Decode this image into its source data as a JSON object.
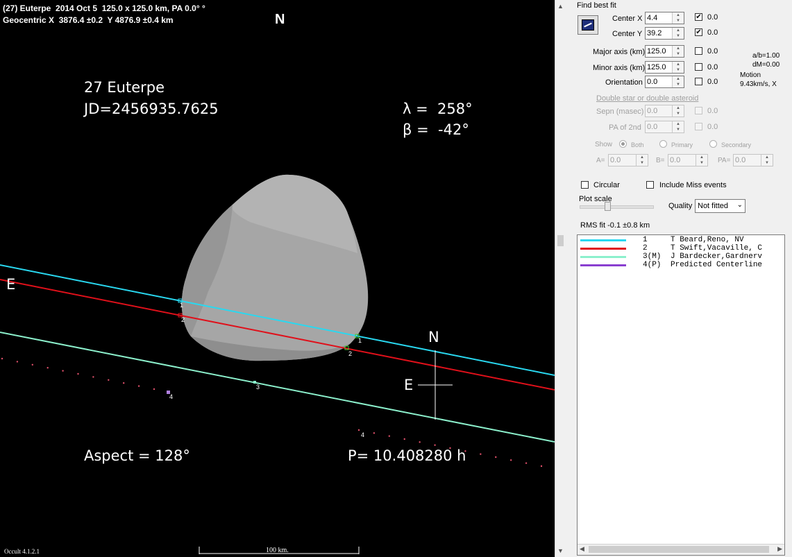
{
  "plot": {
    "header_line1": "(27) Euterpe  2014 Oct 5  125.0 x 125.0 km, PA 0.0° °",
    "header_line2": "Geocentric X  3876.4 ±0.2  Y 4876.9 ±0.4 km",
    "north_top": "N",
    "asteroid_name": "27 Euterpe",
    "jd": "JD=2456935.7625",
    "lambda": "λ =  258°",
    "beta": "β =  -42°",
    "east_left": "E",
    "compass_north": "N",
    "compass_east": "E",
    "aspect": "Aspect = 128°",
    "period": "P= 10.408280 h",
    "version": "Occult 4.1.2.1",
    "scale_bar": "100 km.",
    "chord_labels": {
      "c1a": "1",
      "c2a": "2",
      "c1b": "1",
      "c2b": "2",
      "c3": "3",
      "c4a": "4",
      "c4b": "4"
    },
    "colors": {
      "chord1": "#29d8f0",
      "chord2": "#e0101a",
      "chord3": "#8cf0cc",
      "predicted_dots": "#e0506a",
      "shape": "#a8a8a8"
    }
  },
  "panel": {
    "find_best_fit": "Find best fit",
    "fit_button_icon": "chart-fit-icon",
    "center_x": {
      "label": "Center X",
      "value": "4.4",
      "checked": true,
      "check_value": "0.0"
    },
    "center_y": {
      "label": "Center Y",
      "value": "39.2",
      "checked": true,
      "check_value": "0.0"
    },
    "major_axis": {
      "label": "Major axis (km)",
      "value": "125.0",
      "check_value": "0.0"
    },
    "minor_axis": {
      "label": "Minor axis (km)",
      "value": "125.0",
      "check_value": "0.0"
    },
    "orientation": {
      "label": "Orientation",
      "value": "0.0",
      "check_value": "0.0"
    },
    "ab_ratio": "a/b=1.00",
    "dm": "dM=0.00",
    "motion_label": "Motion",
    "motion_value": "9.43km/s, X",
    "double_star_link": "Double star  or  double asteroid",
    "sepn": {
      "label": "Sepn (masec)",
      "value": "0.0",
      "check_value": "0.0"
    },
    "pa_2nd": {
      "label": "PA of 2nd",
      "value": "0.0",
      "check_value": "0.0"
    },
    "show_label": "Show",
    "show_options": [
      "Both",
      "Primary",
      "Secondary"
    ],
    "a_label": "A=",
    "a_value": "0.0",
    "b_label": "B=",
    "b_value": "0.0",
    "pa_label": "PA=",
    "pa_value": "0.0",
    "circular": "Circular",
    "include_miss": "Include Miss events",
    "plot_scale": "Plot scale",
    "quality_label": "Quality",
    "quality_value": "Not fitted",
    "rms_fit": "RMS fit -0.1 ±0.8 km",
    "legend": [
      {
        "num": "1",
        "name": "T Beard,Reno, NV",
        "color": "#29d8f0"
      },
      {
        "num": "2",
        "name": "T Swift,Vacaville, C",
        "color": "#e0101a"
      },
      {
        "num": "3(M)",
        "name": "J Bardecker,Gardnerv",
        "color": "#8cf0cc"
      },
      {
        "num": "4(P)",
        "name": "Predicted Centerline",
        "color": "#8a3fd0"
      }
    ]
  }
}
